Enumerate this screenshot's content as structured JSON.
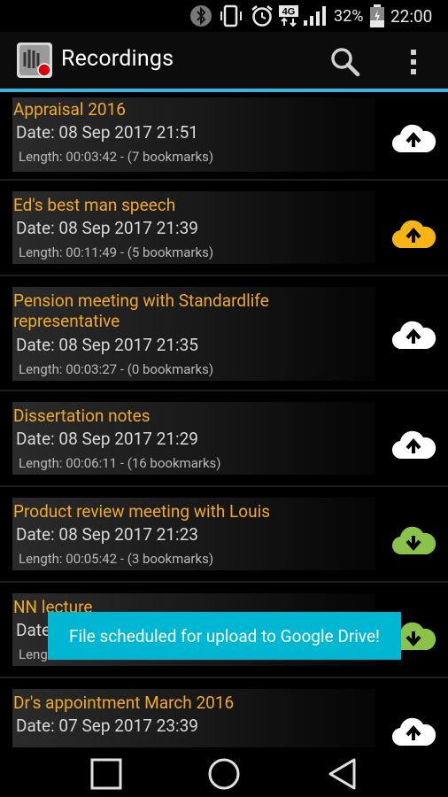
{
  "status_bar": {
    "network": "4G",
    "battery": "32%",
    "time": "22:00"
  },
  "action_bar": {
    "title": "Recordings",
    "icons": [
      "app-icon",
      "search-icon",
      "overflow-menu-icon"
    ]
  },
  "recordings": [
    {
      "title": "Appraisal 2016",
      "date": "Date: 08 Sep 2017 21:51",
      "length": "Length: 00:03:42 - (7 bookmarks)",
      "cloud": "upload",
      "cloud_color": "#ffffff"
    },
    {
      "title": "Ed's best man speech",
      "date": "Date: 08 Sep 2017 21:39",
      "length": "Length: 00:11:49 - (5 bookmarks)",
      "cloud": "upload",
      "cloud_color": "#f7b514"
    },
    {
      "title": "Pension meeting with Standardlife representative",
      "date": "Date: 08 Sep 2017 21:35",
      "length": "Length: 00:03:27 - (0 bookmarks)",
      "cloud": "upload",
      "cloud_color": "#ffffff"
    },
    {
      "title": "Dissertation notes",
      "date": "Date: 08 Sep 2017 21:29",
      "length": "Length: 00:06:11 - (16 bookmarks)",
      "cloud": "upload",
      "cloud_color": "#ffffff"
    },
    {
      "title": "Product review meeting with Louis",
      "date": "Date: 08 Sep 2017 21:23",
      "length": "Length: 00:05:42 - (3 bookmarks)",
      "cloud": "download",
      "cloud_color": "#8bc34a"
    },
    {
      "title": "NN lecture",
      "date": "Date",
      "length": "Leng",
      "cloud": "download",
      "cloud_color": "#8bc34a"
    },
    {
      "title": "Dr's appointment March 2016",
      "date": "Date: 07 Sep 2017 23:39",
      "length": "",
      "cloud": "upload",
      "cloud_color": "#ffffff"
    }
  ],
  "toast": "File scheduled for upload to Google Drive!",
  "nav_bar": [
    "recents-button",
    "home-button",
    "back-button"
  ],
  "colors": {
    "accent": "#33b5e5",
    "title_text": "#f0a92e",
    "toast_bg": "#00b7d3"
  }
}
